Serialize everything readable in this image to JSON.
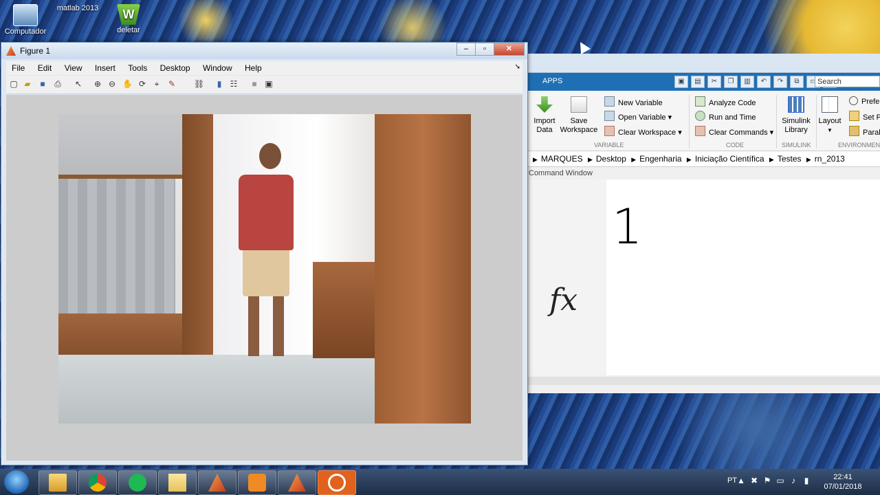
{
  "desktop": {
    "icons": [
      {
        "label": "Computador",
        "icon": "computer-icon"
      },
      {
        "label": "matlab 2013",
        "icon": "matlab-icon"
      },
      {
        "label": "deletar",
        "icon": "word-icon"
      }
    ]
  },
  "figure": {
    "title": "Figure 1",
    "menu": [
      "File",
      "Edit",
      "View",
      "Insert",
      "Tools",
      "Desktop",
      "Window",
      "Help"
    ],
    "toolbar_icons": [
      "new-figure-icon",
      "open-file-icon",
      "save-icon",
      "print-icon",
      "pointer-icon",
      "zoom-in-icon",
      "zoom-out-icon",
      "pan-icon",
      "rotate-icon",
      "data-cursor-icon",
      "brush-icon",
      "link-icon",
      "colorbar-icon",
      "legend-icon",
      "hide-plot-tools-icon",
      "show-plot-tools-icon"
    ]
  },
  "matlab": {
    "tab_apps": "APPS",
    "search_placeholder": "Search Documentation",
    "ribbon": {
      "import_data": "Import\nData",
      "save_workspace": "Save\nWorkspace",
      "new_variable": "New Variable",
      "open_variable": "Open Variable",
      "clear_workspace": "Clear Workspace",
      "analyze_code": "Analyze Code",
      "run_and_time": "Run and Time",
      "clear_commands": "Clear Commands",
      "simulink_library": "Simulink\nLibrary",
      "layout": "Layout",
      "preferences": "Prefer",
      "set_path": "Set Pa",
      "parallel": "Paralle",
      "sections": {
        "variable": "VARIABLE",
        "code": "CODE",
        "simulink": "SIMULINK",
        "environment": "ENVIRONMENT"
      }
    },
    "path": [
      "MARQUES",
      "Desktop",
      "Engenharia",
      "Iniciação Científica",
      "Testes",
      "rn_2013"
    ],
    "command_window_title": "Command Window",
    "output": "1",
    "prompt_symbol": "fx"
  },
  "taskbar": {
    "apps": [
      "explorer-icon",
      "chrome-icon",
      "spotify-icon",
      "folder-icon",
      "matlab-icon",
      "media-player-icon",
      "matlab-icon",
      "app-icon"
    ],
    "tray": {
      "lang": "PT",
      "time": "22:41",
      "date": "07/01/2018"
    }
  }
}
